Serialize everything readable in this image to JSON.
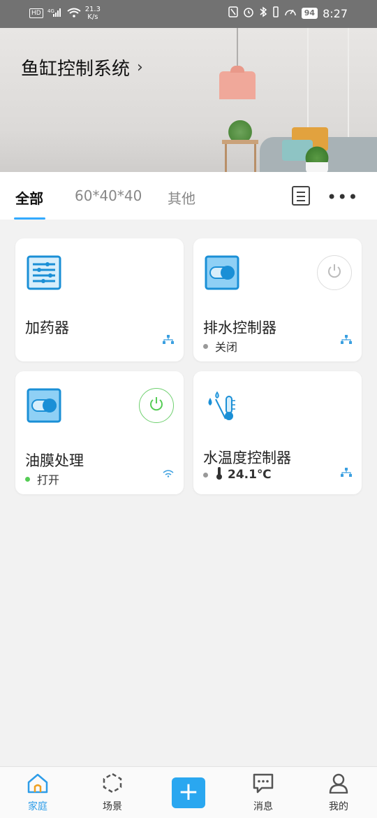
{
  "status_bar": {
    "hd": "HD",
    "network": "⁴ᴳ",
    "speed_value": "21.3",
    "speed_unit": "K/s",
    "battery": "94",
    "time": "8:27"
  },
  "banner": {
    "title": "鱼缸控制系统",
    "chevron": "›"
  },
  "tabs": [
    {
      "label": "全部",
      "active": true
    },
    {
      "label": "60*40*40",
      "active": false
    },
    {
      "label": "其他",
      "active": false
    }
  ],
  "toolbar": {
    "more": "•••"
  },
  "devices": [
    {
      "name": "加药器",
      "status": "",
      "icon": "doser-icon",
      "connection": "network-icon"
    },
    {
      "name": "排水控制器",
      "status": "关闭",
      "icon": "switch-icon",
      "power": "off",
      "connection": "network-icon"
    },
    {
      "name": "油膜处理",
      "status": "打开",
      "icon": "switch-icon",
      "power": "on",
      "connection": "wifi-icon"
    },
    {
      "name": "水温度控制器",
      "status": "24.1℃",
      "icon": "water-temp-icon",
      "connection": "network-icon"
    }
  ],
  "nav": {
    "home": "家庭",
    "scene": "场景",
    "add": "+",
    "messages": "消息",
    "mine": "我的"
  },
  "colors": {
    "accent": "#2aa7f0",
    "icon_blue": "#1a8fd6",
    "power_on": "#55cc55",
    "power_off": "#bbbbbb"
  }
}
